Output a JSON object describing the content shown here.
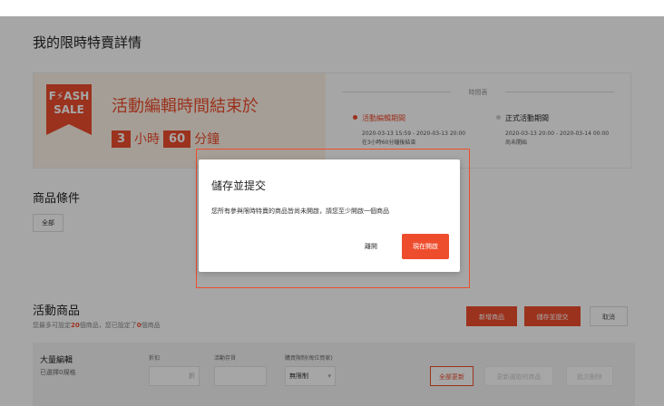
{
  "page": {
    "title": "我的限時特賣詳情"
  },
  "banner": {
    "logo_line1": "F⚡ASH",
    "logo_line2": "SALE",
    "headline": "活動編輯時間結束於",
    "hours": "3",
    "hours_unit": "小時",
    "minutes": "60",
    "minutes_unit": "分鐘",
    "period_header": "時間表",
    "edit_period": {
      "label": "活動編輯期間",
      "range": "2020-03-13 15:59 - 2020-03-13 20:00",
      "note": "在3小時60分鐘後結束"
    },
    "official_period": {
      "label": "正式活動期間",
      "range": "2020-03-13 20:00 - 2020-03-14 00:00",
      "note": "尚未開始"
    }
  },
  "conditions": {
    "title": "商品條件",
    "chip": "全部"
  },
  "products": {
    "title": "活動商品",
    "sub_prefix": "您最多可設定",
    "max": "20",
    "sub_mid": "個商品，您已設定了",
    "set": "0",
    "sub_suffix": "個商品",
    "add_button": "新增商品",
    "save_button": "儲存並提交",
    "cancel_button": "取消"
  },
  "bulk": {
    "title": "大量編輯",
    "selected": "已選擇0規格",
    "discount_label": "折扣",
    "discount_unit": "折",
    "stock_label": "活動存貨",
    "limit_label": "購買限制(每位買家)",
    "limit_value": "無限制",
    "update_all": "全部更新",
    "update_selected": "更新選取的商品",
    "batch_delete": "批次刪除"
  },
  "modal": {
    "title": "儲存並提交",
    "body": "您所有參與限時特賣的商品皆尚未開啟，請您至少開啟一個商品",
    "leave": "離開",
    "open_now": "現在開啟"
  },
  "colors": {
    "accent": "#ee4d2d",
    "banner_bg": "#fdf3e7"
  }
}
